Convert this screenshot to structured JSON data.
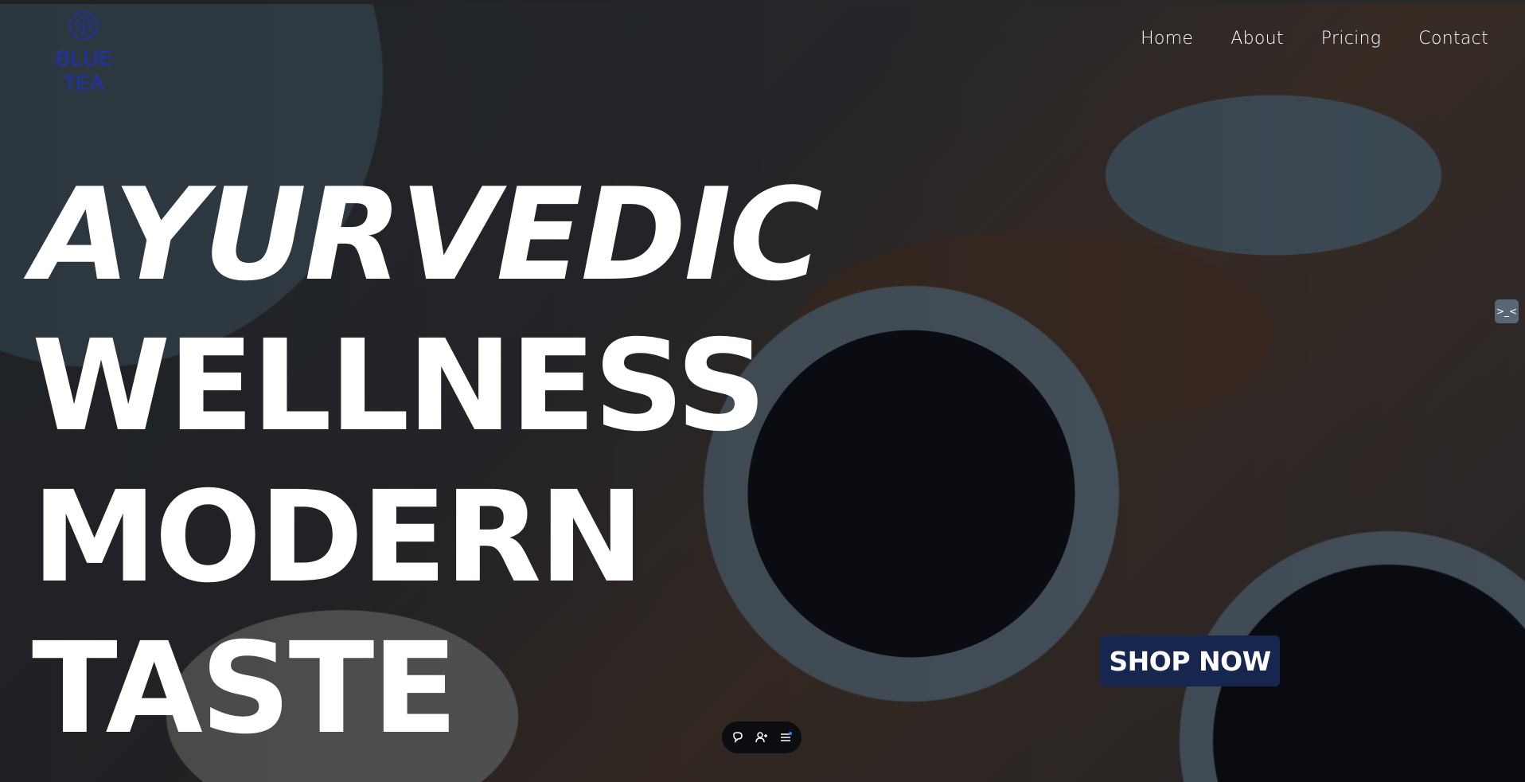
{
  "brand": {
    "name": "BLUE TEA",
    "logo_icon": "tea-leaf-circle-icon",
    "color": "#22348f"
  },
  "nav": {
    "items": [
      {
        "label": "Home"
      },
      {
        "label": "About"
      },
      {
        "label": "Pricing"
      },
      {
        "label": "Contact"
      }
    ]
  },
  "hero": {
    "lines": [
      "AYURVEDIC",
      "WELLNESS",
      "MODERN",
      "TASTE"
    ],
    "cta_label": "SHOP NOW",
    "cta_color": "#17264f"
  },
  "side_widget": {
    "label": ">_<",
    "icon": "widget-toggle-icon"
  },
  "floating_toolbar": {
    "icons": [
      "comment-icon",
      "add-user-icon",
      "menu-list-icon"
    ]
  }
}
